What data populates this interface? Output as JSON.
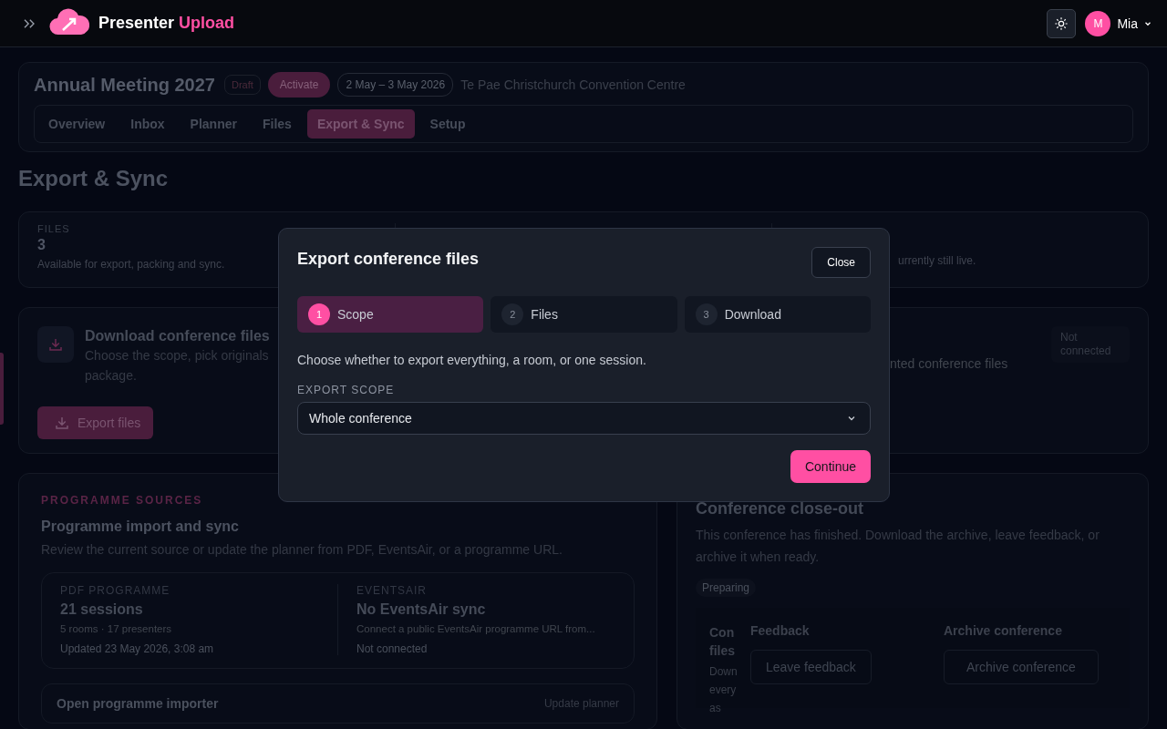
{
  "header": {
    "brand": {
      "first": "Presenter",
      "second": "Upload"
    },
    "user": {
      "initial": "M",
      "name": "Mia"
    }
  },
  "event": {
    "title": "Annual Meeting 2027",
    "status": "Draft",
    "action": "Activate",
    "dates": "2 May – 3 May 2026",
    "venue": "Te Pae Christchurch Convention Centre",
    "tabs": [
      {
        "label": "Overview",
        "selected": false
      },
      {
        "label": "Inbox",
        "selected": false
      },
      {
        "label": "Planner",
        "selected": false
      },
      {
        "label": "Files",
        "selected": false
      },
      {
        "label": "Export & Sync",
        "selected": true
      },
      {
        "label": "Setup",
        "selected": false
      }
    ]
  },
  "page_title": "Export & Sync",
  "stats": {
    "files": {
      "label": "FILES",
      "value": "3",
      "note": "Available for export, packing and sync."
    },
    "sharing_note": "urrently still live."
  },
  "download": {
    "title": "Download conference files",
    "description": "Choose the scope, pick originals",
    "description_end": "package.",
    "button": "Export files",
    "right_text": "nted conference files",
    "badge": "Not connected"
  },
  "programme": {
    "eyebrow": "PROGRAMME SOURCES",
    "title": "Programme import and sync",
    "description": "Review the current source or update the planner from PDF, EventsAir, or a programme URL.",
    "sources": [
      {
        "label": "PDF PROGRAMME",
        "value": "21 sessions",
        "detail": "5 rooms · 17 presenters",
        "note": "Updated 23 May 2026, 3:08 am"
      },
      {
        "label": "EVENTSAIR",
        "value": "No EventsAir sync",
        "detail": "Connect a public EventsAir programme URL from...",
        "note": "Not connected"
      }
    ],
    "importer": {
      "title": "Open programme importer",
      "action": "Update planner"
    }
  },
  "closeout": {
    "title": "Conference close-out",
    "description": "This conference has finished. Download the archive, leave feedback, or archive it when ready.",
    "badge": "Preparing",
    "panels": [
      {
        "kind": "clipped",
        "title": "Con files",
        "description": "Down every as"
      },
      {
        "kind": "action",
        "title": "Feedback",
        "button": "Leave feedback"
      },
      {
        "kind": "action",
        "title": "Archive conference",
        "button": "Archive conference"
      }
    ]
  },
  "modal": {
    "title": "Export conference files",
    "close": "Close",
    "steps": [
      {
        "number": "1",
        "label": "Scope",
        "selected": true
      },
      {
        "number": "2",
        "label": "Files",
        "selected": false
      },
      {
        "number": "3",
        "label": "Download",
        "selected": false
      }
    ],
    "prompt": "Choose whether to export everything, a room, or one session.",
    "field_label": "EXPORT SCOPE",
    "field_value": "Whole conference",
    "primary": "Continue"
  }
}
